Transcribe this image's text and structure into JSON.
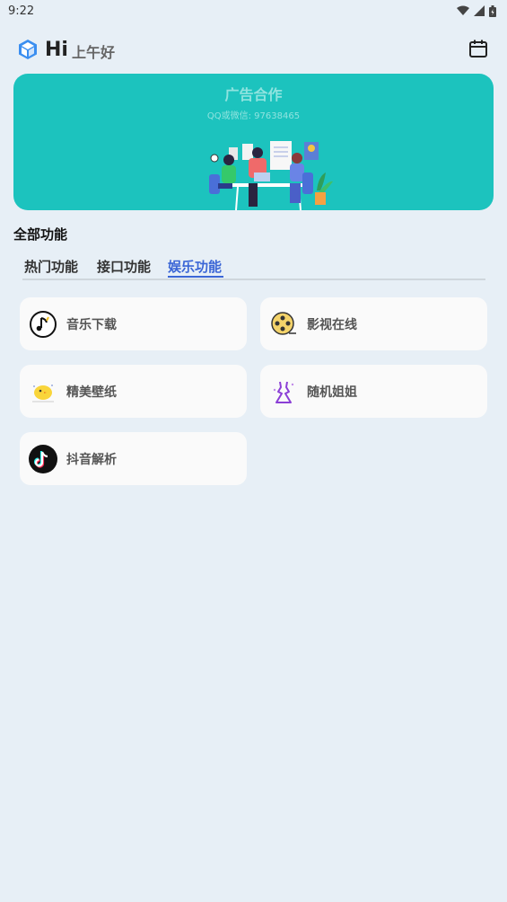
{
  "status_bar": {
    "time": "9:22"
  },
  "header": {
    "hi": "Hi",
    "greeting": "上午好"
  },
  "banner": {
    "title": "广告合作",
    "subtitle": "QQ或微信: 97638465"
  },
  "section": {
    "title": "全部功能"
  },
  "tabs": [
    {
      "label": "热门功能",
      "active": false
    },
    {
      "label": "接口功能",
      "active": false
    },
    {
      "label": "娱乐功能",
      "active": true
    }
  ],
  "features": [
    {
      "label": "音乐下载",
      "icon": "music-note-icon"
    },
    {
      "label": "影视在线",
      "icon": "film-reel-icon"
    },
    {
      "label": "精美壁纸",
      "icon": "wallpaper-chick-icon"
    },
    {
      "label": "随机姐姐",
      "icon": "dress-icon"
    },
    {
      "label": "抖音解析",
      "icon": "tiktok-icon"
    }
  ],
  "colors": {
    "accent": "#3b66d6",
    "banner": "#1cc3be",
    "background": "#e7eff6"
  }
}
